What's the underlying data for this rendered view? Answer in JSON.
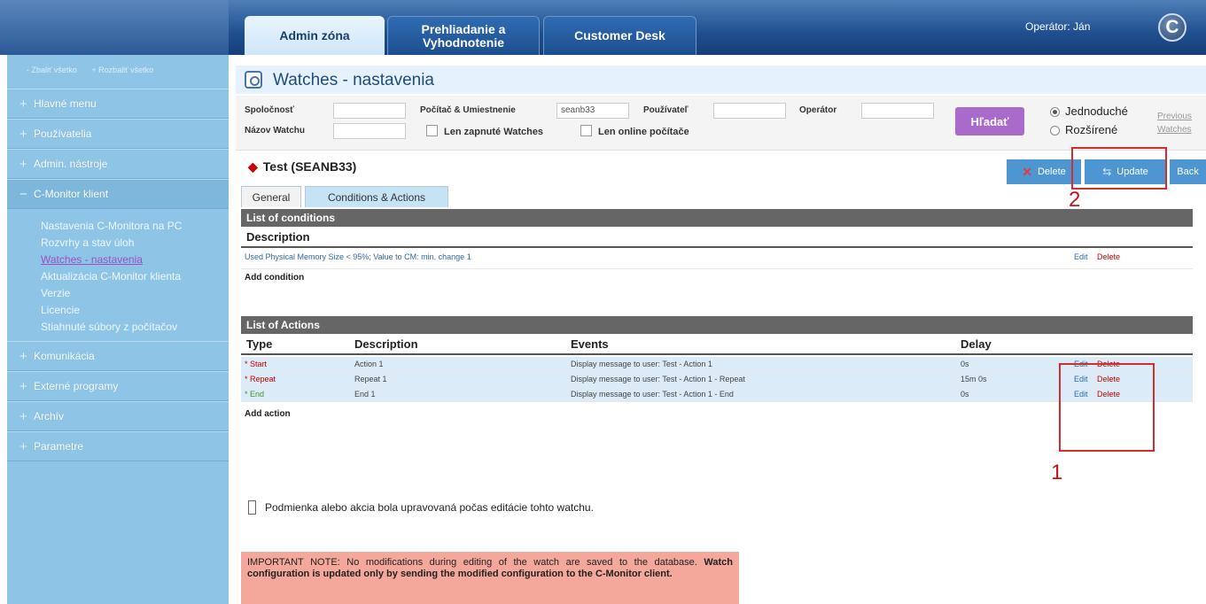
{
  "header": {
    "tabs": [
      {
        "label_line1": "Admin zóna",
        "label_line2": ""
      },
      {
        "label_line1": "Prehliadanie a",
        "label_line2": "Vyhodnotenie"
      },
      {
        "label_line1": "Customer Desk",
        "label_line2": ""
      }
    ],
    "operator": "Operátor: Ján",
    "logo_letter": "C"
  },
  "sidebar": {
    "collapse_all": "- Zbaliť všetko",
    "expand_all": "+ Rozbaliť všetko",
    "items": [
      {
        "icon": "+",
        "label": "Hlavné menu"
      },
      {
        "icon": "+",
        "label": "Používatelia"
      },
      {
        "icon": "+",
        "label": "Admin. nástroje"
      },
      {
        "icon": "−",
        "label": "C-Monitor klient"
      }
    ],
    "subitems": [
      "Nastavenia C-Monitora na PC",
      "Rozvrhy a stav úloh",
      "Watches - nastavenia",
      "Aktualizácia C-Monitor klienta",
      "Verzie",
      "Licencie",
      "Stiahnuté súbory z počítačov"
    ],
    "bottom_items": [
      {
        "icon": "+",
        "label": "Komunikácia"
      },
      {
        "icon": "+",
        "label": "Externé programy"
      },
      {
        "icon": "+",
        "label": "Archív"
      },
      {
        "icon": "+",
        "label": "Parametre"
      }
    ]
  },
  "page": {
    "title": "Watches - nastavenia"
  },
  "filter": {
    "company_label": "Spoločnosť",
    "company_value": "",
    "computer_label": "Počítač & Umiestnenie",
    "computer_value": "seanb33",
    "user_label": "Používateľ",
    "user_value": "",
    "operator_label": "Operátor",
    "operator_value": "",
    "watch_name_label": "Názov Watchu",
    "watch_name_value": "",
    "only_enabled_label": "Len zapnuté Watches",
    "only_online_label": "Len online počítače",
    "search_button": "Hľadať",
    "mode_simple": "Jednoduché",
    "mode_extended": "Rozšírené",
    "previous_link": "Previous\nWatches"
  },
  "watch": {
    "title": "Test (SEANB33)",
    "delete_button": "Delete",
    "update_button": "Update",
    "back_button": "Back",
    "tab_general": "General",
    "tab_conditions": "Conditions & Actions"
  },
  "conditions": {
    "group_title": "List of conditions",
    "col_description": "Description",
    "rows": [
      {
        "description": "Used Physical Memory Size < 95%; Value to CM: min. change 1",
        "edit": "Edit",
        "delete": "Delete"
      }
    ],
    "add_link": "Add condition"
  },
  "actions": {
    "group_title": "List of Actions",
    "col_type": "Type",
    "col_description": "Description",
    "col_events": "Events",
    "col_delay": "Delay",
    "rows": [
      {
        "type": "* Start",
        "description": "Action 1",
        "events": "Display message to user: Test - Action 1",
        "delay": "0s",
        "edit": "Edit",
        "delete": "Delete"
      },
      {
        "type": "* Repeat",
        "description": "Repeat 1",
        "events": "Display message to user: Test - Action 1 - Repeat",
        "delay": "15m 0s",
        "edit": "Edit",
        "delete": "Delete"
      },
      {
        "type": "* End",
        "description": "End 1",
        "events": "Display message to user: Test - Action 1 - End",
        "delay": "0s",
        "edit": "Edit",
        "delete": "Delete"
      }
    ],
    "add_link": "Add action"
  },
  "legend_text": "Podmienka alebo akcia bola upravovaná počas editácie tohto watchu.",
  "note": {
    "normal": "IMPORTANT NOTE: No modifications during editing of the watch are saved to the database.",
    "bold": "Watch configuration is updated only by sending the modified configuration to the C-Monitor client."
  },
  "callouts": {
    "one": "1",
    "two": "2"
  },
  "colors": {
    "accent": "#4e96d2",
    "search": "#a86bc9",
    "sidebar": "#8ec5e6",
    "note": "#f4a79b",
    "callout": "#d12f2f"
  }
}
